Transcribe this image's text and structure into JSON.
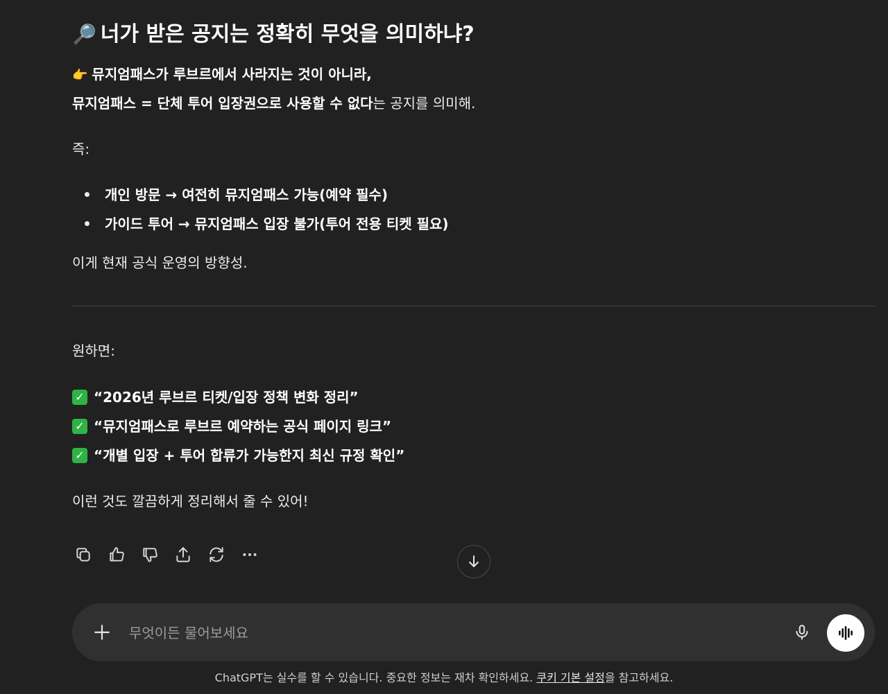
{
  "message": {
    "heading_icon": "magnifier-emoji",
    "heading_icon_glyph": "🔎",
    "heading": "너가 받은 공지는 정확히 무엇을 의미하냐?",
    "line1_icon": "pointing-hand-emoji",
    "line1_icon_glyph": "👉",
    "line1": "뮤지엄패스가 루브르에서 사라지는 것이 아니라,",
    "line2_bold": "뮤지엄패스 = 단체 투어 입장권으로 사용할 수 없다",
    "line2_rest": "는 공지를 의미해.",
    "so_label": "즉:",
    "bullets": [
      "개인 방문 → 여전히 뮤지엄패스 가능(예약 필수)",
      "가이드 투어 → 뮤지엄패스 입장 불가(투어 전용 티켓 필요)"
    ],
    "summary": "이게 현재 공식 운영의 방향성.",
    "offer_label": "원하면:",
    "check_icon_glyph": "✓",
    "checks": [
      "“2026년 루브르 티켓/입장 정책 변화 정리”",
      "“뮤지엄패스로 루브르 예약하는 공식 페이지 링크”",
      "“개별 입장 + 투어 합류가 가능한지 최신 규정 확인”"
    ],
    "closing": "이런 것도 깔끔하게 정리해서 줄 수 있어!"
  },
  "actions": [
    "copy-icon",
    "thumbs-up-icon",
    "thumbs-down-icon",
    "share-icon",
    "regenerate-icon",
    "more-icon"
  ],
  "composer": {
    "placeholder": "무엇이든 물어보세요",
    "value": ""
  },
  "footer": {
    "text_before": "ChatGPT는 실수를 할 수 있습니다. 중요한 정보는 재차 확인하세요. ",
    "link": "쿠키 기본 설정",
    "text_after": "을 참고하세요."
  },
  "colors": {
    "background": "#212121",
    "composer": "#303030",
    "check": "#2fb344"
  }
}
